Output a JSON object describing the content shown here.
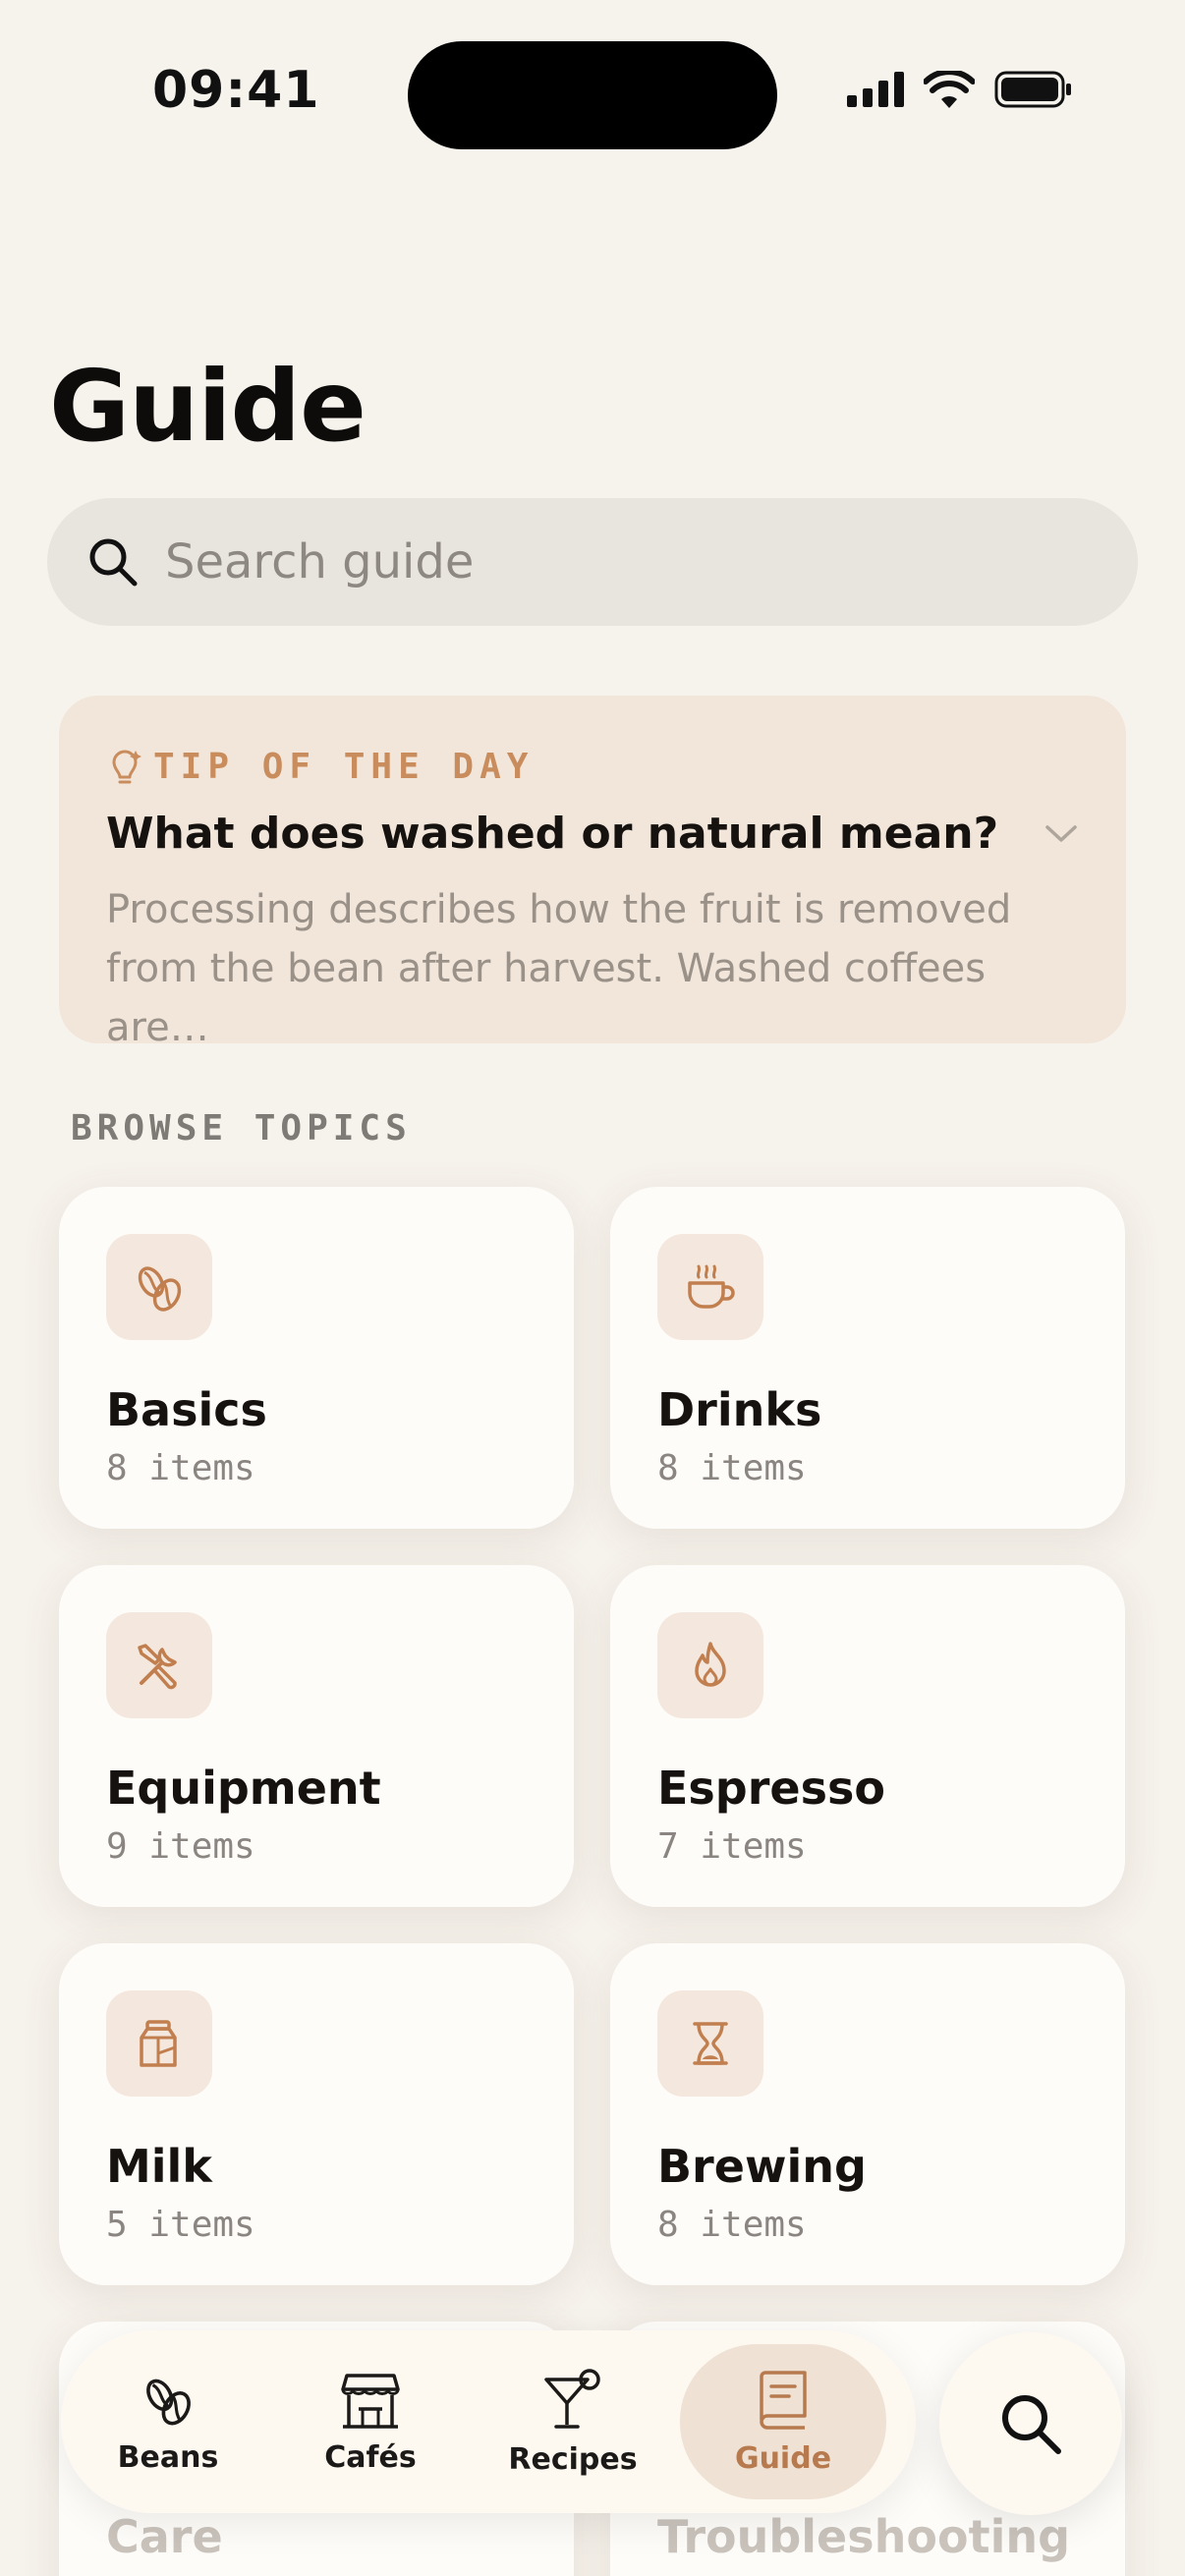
{
  "status_bar": {
    "time": "09:41",
    "icons": [
      "signal-icon",
      "wifi-icon",
      "battery-icon"
    ]
  },
  "page": {
    "title": "Guide"
  },
  "search": {
    "placeholder": "Search guide",
    "icon": "search-icon"
  },
  "tip": {
    "icon": "lightbulb-icon",
    "label": "TIP OF THE DAY",
    "question": "What does washed or natural mean?",
    "body": "Processing describes how the fruit is removed from the bean after harvest. Washed coffees are…",
    "expand_icon": "chevron-down-icon"
  },
  "browse": {
    "label": "BROWSE TOPICS",
    "topics": [
      {
        "name": "Basics",
        "count": "8 items",
        "icon": "coffee-bean-icon"
      },
      {
        "name": "Drinks",
        "count": "8 items",
        "icon": "coffee-cup-icon"
      },
      {
        "name": "Equipment",
        "count": "9 items",
        "icon": "tools-icon"
      },
      {
        "name": "Espresso",
        "count": "7 items",
        "icon": "flame-icon"
      },
      {
        "name": "Milk",
        "count": "5 items",
        "icon": "milk-carton-icon"
      },
      {
        "name": "Brewing",
        "count": "8 items",
        "icon": "hourglass-icon"
      },
      {
        "name": "Care",
        "count": "",
        "icon": ""
      },
      {
        "name": "Troubleshooting",
        "count": "",
        "icon": ""
      }
    ]
  },
  "tab_bar": {
    "tabs": [
      {
        "label": "Beans",
        "icon": "coffee-bean-icon",
        "active": false
      },
      {
        "label": "Cafés",
        "icon": "storefront-icon",
        "active": false
      },
      {
        "label": "Recipes",
        "icon": "cocktail-glass-icon",
        "active": false
      },
      {
        "label": "Guide",
        "icon": "book-icon",
        "active": true
      }
    ],
    "search_button_icon": "search-icon"
  },
  "colors": {
    "background": "#f6f2ec",
    "accent": "#c98c5c",
    "active_tab_text": "#b77a4e",
    "tip_background": "#f2e6da"
  }
}
